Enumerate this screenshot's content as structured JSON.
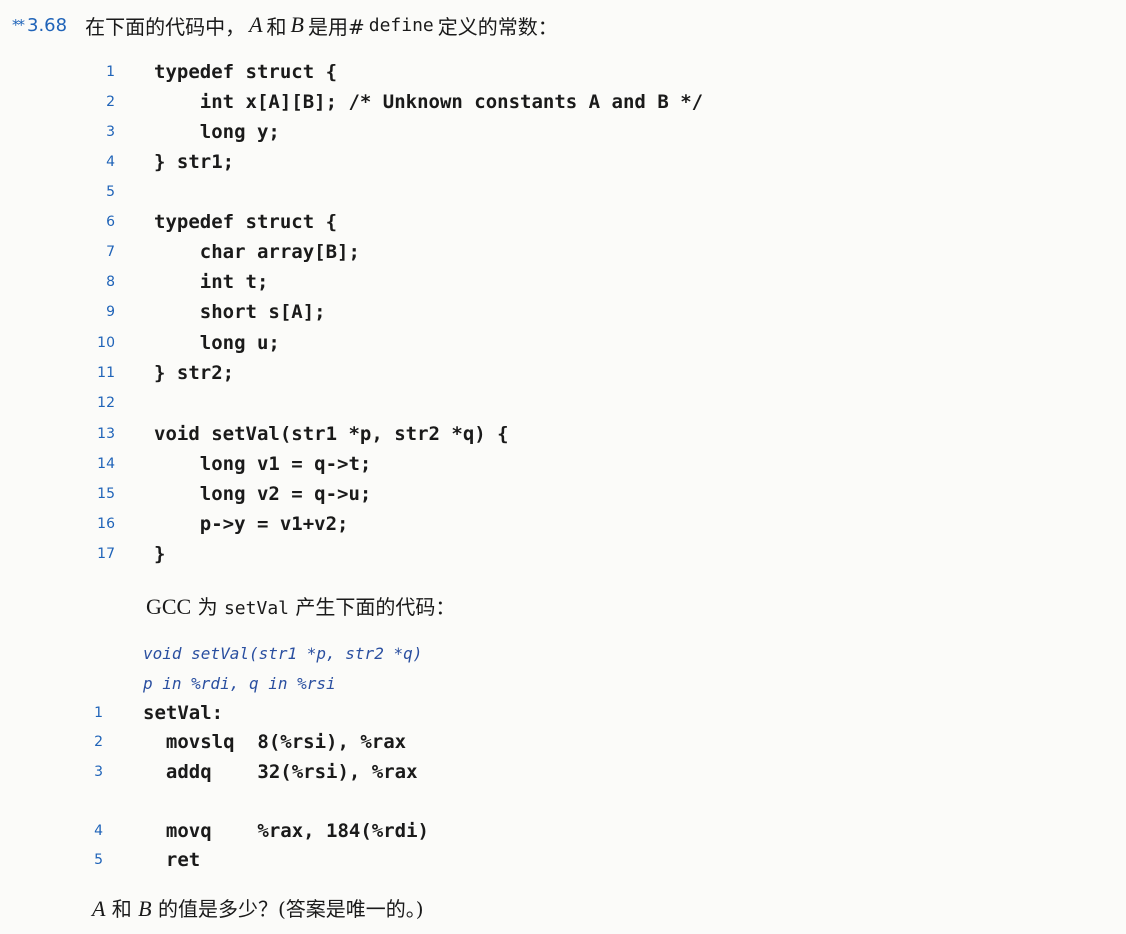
{
  "problem": {
    "stars": "**",
    "number": "3.68",
    "intro_a": "在下面的代码中，",
    "var_a": "A",
    "intro_b": "和",
    "var_b": "B",
    "intro_c": "是用#",
    "define_kw": "define",
    "intro_d": "定义的常数："
  },
  "c_code": [
    {
      "n": "1",
      "t": "typedef struct {"
    },
    {
      "n": "2",
      "t": "    int x[A][B]; /* Unknown constants A and B */"
    },
    {
      "n": "3",
      "t": "    long y;"
    },
    {
      "n": "4",
      "t": "} str1;"
    },
    {
      "n": "5",
      "t": ""
    },
    {
      "n": "6",
      "t": "typedef struct {"
    },
    {
      "n": "7",
      "t": "    char array[B];"
    },
    {
      "n": "8",
      "t": "    int t;"
    },
    {
      "n": "9",
      "t": "    short s[A];"
    },
    {
      "n": "10",
      "t": "    long u;"
    },
    {
      "n": "11",
      "t": "} str2;"
    },
    {
      "n": "12",
      "t": ""
    },
    {
      "n": "13",
      "t": "void setVal(str1 *p, str2 *q) {"
    },
    {
      "n": "14",
      "t": "    long v1 = q->t;"
    },
    {
      "n": "15",
      "t": "    long v2 = q->u;"
    },
    {
      "n": "16",
      "t": "    p->y = v1+v2;"
    },
    {
      "n": "17",
      "t": "}"
    }
  ],
  "gcc_line": {
    "gcc": "GCC",
    "part_a": " 为 ",
    "func": "setVal",
    "part_b": " 产生下面的代码："
  },
  "asm_comments": [
    "void setVal(str1 *p, str2 *q)",
    "p in %rdi, q in %rsi"
  ],
  "asm_code": [
    {
      "n": "1",
      "t": "setVal:"
    },
    {
      "n": "2",
      "t": "  movslq  8(%rsi), %rax"
    },
    {
      "n": "3",
      "t": "  addq    32(%rsi), %rax"
    },
    {
      "n": "4",
      "t": "  movq    %rax, 184(%rdi)"
    },
    {
      "n": "5",
      "t": "  ret"
    }
  ],
  "question": {
    "var_a": "A",
    "part_a": " 和 ",
    "var_b": "B",
    "part_b": " 的值是多少？(答案是唯一的。)"
  }
}
